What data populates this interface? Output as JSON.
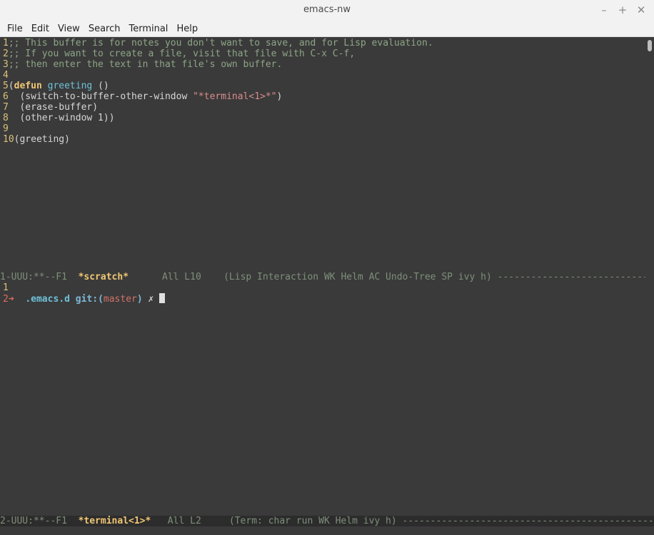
{
  "window": {
    "title": "emacs-nw",
    "minimize": "–",
    "maximize": "+",
    "close": "✕"
  },
  "menu": [
    "File",
    "Edit",
    "View",
    "Search",
    "Terminal",
    "Help"
  ],
  "buffer": {
    "lines": [
      {
        "n": "1",
        "parts": [
          {
            "c": "comment",
            "t": ";; This buffer is for notes you don't want to save, and for Lisp evaluation."
          }
        ]
      },
      {
        "n": "2",
        "parts": [
          {
            "c": "comment",
            "t": ";; If you want to create a file, visit that file with C-x C-f,"
          }
        ]
      },
      {
        "n": "3",
        "parts": [
          {
            "c": "comment",
            "t": ";; then enter the text in that file's own buffer."
          }
        ]
      },
      {
        "n": "4",
        "parts": []
      },
      {
        "n": "5",
        "parts": [
          {
            "c": "plain",
            "t": "("
          },
          {
            "c": "kw",
            "t": "defun"
          },
          {
            "c": "plain",
            "t": " "
          },
          {
            "c": "fn",
            "t": "greeting"
          },
          {
            "c": "plain",
            "t": " ()"
          }
        ]
      },
      {
        "n": "6",
        "parts": [
          {
            "c": "plain",
            "t": "  (switch-to-buffer-other-window "
          },
          {
            "c": "str",
            "t": "\"*terminal<1>*\""
          },
          {
            "c": "plain",
            "t": ")"
          }
        ]
      },
      {
        "n": "7",
        "parts": [
          {
            "c": "plain",
            "t": "  (erase-buffer)"
          }
        ]
      },
      {
        "n": "8",
        "parts": [
          {
            "c": "plain",
            "t": "  (other-window 1))"
          }
        ]
      },
      {
        "n": "9",
        "parts": []
      },
      {
        "n": "10",
        "parts": [
          {
            "c": "plain",
            "t": "(greeting)"
          }
        ]
      }
    ]
  },
  "modeline1": {
    "prefix": "1-UUU:**--F1  ",
    "buffer": "*scratch*",
    "rest": "      All L10    (Lisp Interaction WK Helm AC Undo-Tree SP ivy h) ------------------------------------------"
  },
  "terminal": {
    "line1": "1",
    "prompt_num": "2",
    "prompt_arrow": "➜",
    "dir": ".emacs.d",
    "git_label": "git:",
    "paren_open": "(",
    "branch": "master",
    "paren_close": ")",
    "dirty": "✗"
  },
  "modeline2": {
    "prefix": "2-UUU:**--F1  ",
    "buffer": "*terminal<1>*",
    "rest": "   All L2     (Term: char run WK Helm ivy h) ---------------------------------------------------------"
  }
}
